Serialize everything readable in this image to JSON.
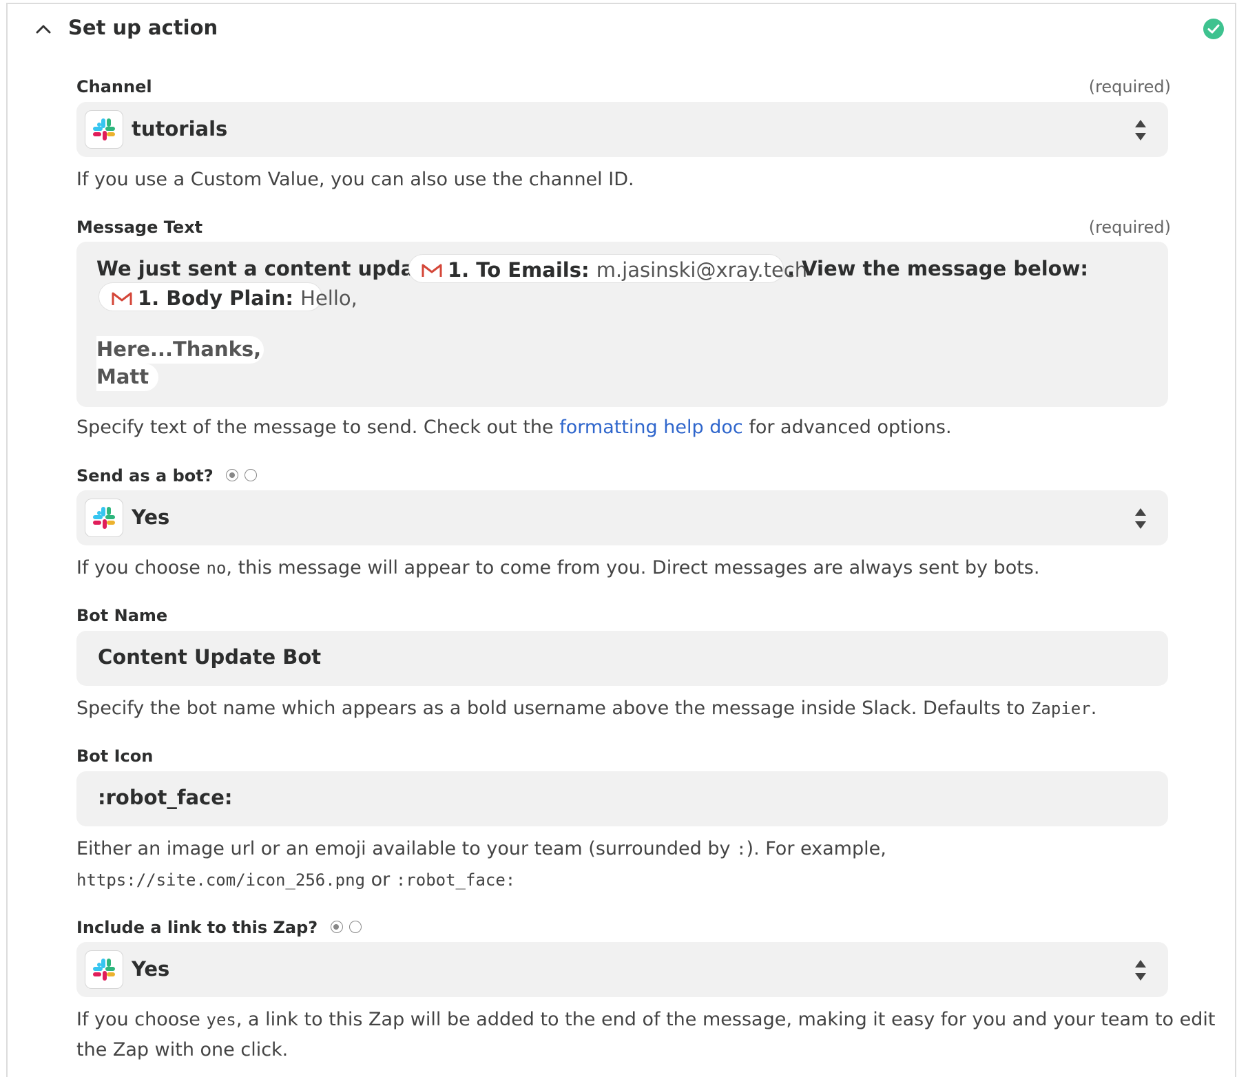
{
  "header": {
    "title": "Set up action"
  },
  "channel": {
    "label": "Channel",
    "required": "(required)",
    "value": "tutorials",
    "help": "If you use a Custom Value, you can also use the channel ID."
  },
  "message": {
    "label": "Message Text",
    "required": "(required)",
    "line1_prefix": "We just sent a content update to",
    "pill1_key": "1. To Emails:",
    "pill1_value": "m.jasinski@xray.tech",
    "line1_suffix": ". View the message below:",
    "pill2_key": "1. Body Plain:",
    "pill2_value": "Hello,",
    "line3": "Here...Thanks,",
    "line4": "Matt",
    "help_prefix": "Specify text of the message to send. Check out the",
    "help_link": "formatting help doc",
    "help_suffix": "for advanced options."
  },
  "send_as_bot": {
    "label": "Send as a bot?",
    "value": "Yes",
    "help_prefix": "If you choose",
    "help_code": "no",
    "help_suffix": ", this message will appear to come from you. Direct messages are always sent by bots."
  },
  "bot_name": {
    "label": "Bot Name",
    "value": "Content Update Bot",
    "help_prefix": "Specify the bot name which appears as a bold username above the message inside Slack. Defaults to",
    "help_code": "Zapier",
    "help_suffix": "."
  },
  "bot_icon": {
    "label": "Bot Icon",
    "value": ":robot_face:",
    "help_line1_prefix": "Either an image url or an emoji available to your team (surrounded by",
    "help_line1_code": ":",
    "help_line1_suffix": "). For example,",
    "help_line2_code1": "https://site.com/icon_256.png",
    "help_line2_or": "or",
    "help_line2_code2": ":robot_face:"
  },
  "include_link": {
    "label": "Include a link to this Zap?",
    "value": "Yes",
    "help_line1_prefix": "If you choose",
    "help_line1_code": "yes",
    "help_line1_suffix": ", a link to this Zap will be added to the end of the message, making it easy for you and your team to edit",
    "help_line2": "the Zap with one click."
  },
  "colors": {
    "accent": "#2f66cc",
    "success": "#3ec28f",
    "field_bg": "#f1f1f1"
  }
}
